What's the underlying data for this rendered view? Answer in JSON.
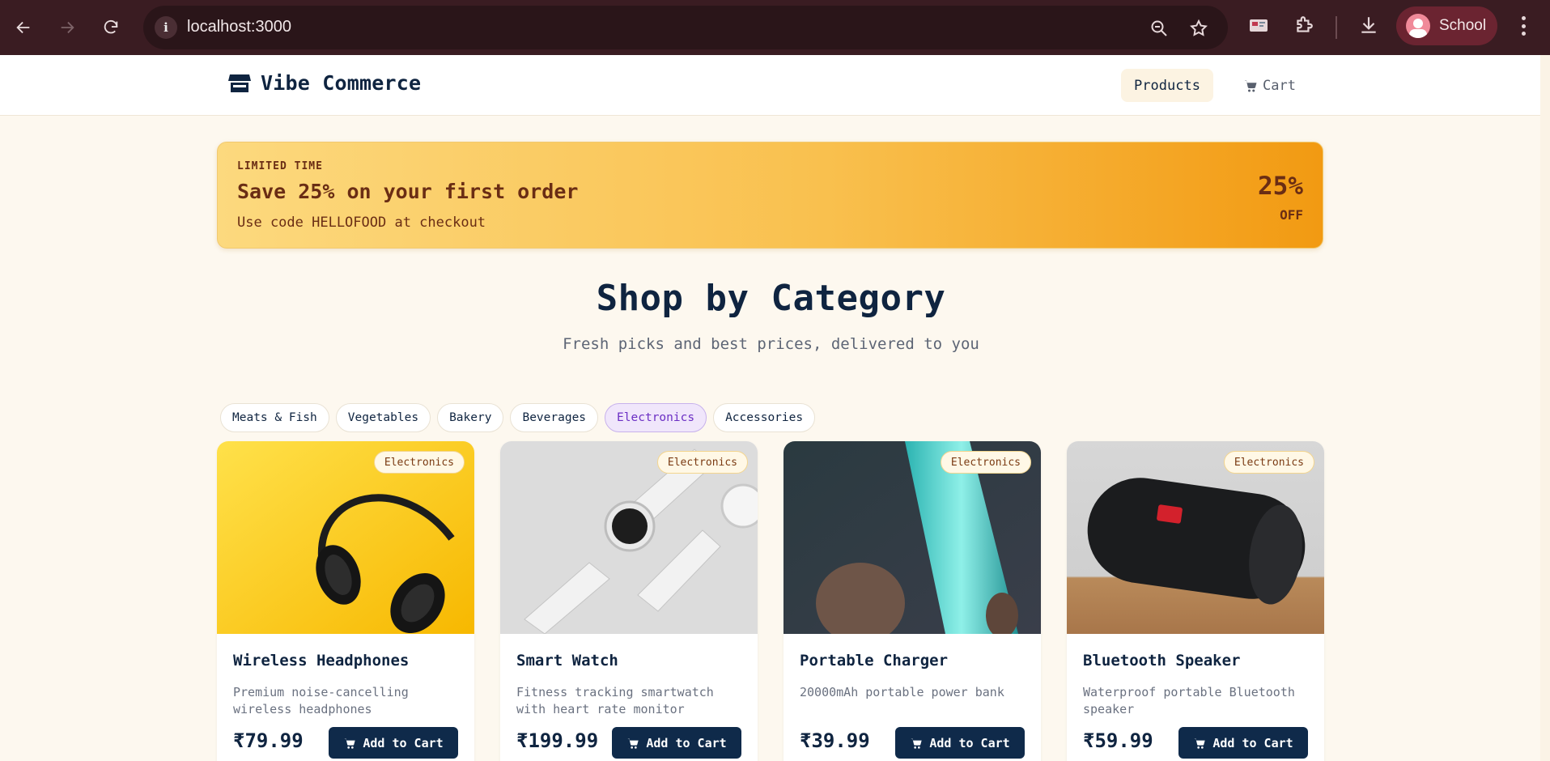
{
  "browser": {
    "url": "localhost:3000",
    "profile_name": "School"
  },
  "header": {
    "brand": "Vibe Commerce",
    "nav": {
      "products": "Products",
      "cart": "Cart"
    }
  },
  "promo": {
    "eyebrow": "LIMITED TIME",
    "headline": "Save 25% on your first order",
    "subtext": "Use code HELLOFOOD at checkout",
    "discount": "25%",
    "discount_suffix": "OFF"
  },
  "section": {
    "title": "Shop by Category",
    "subtitle": "Fresh picks and best prices, delivered to you"
  },
  "categories": {
    "items": [
      "Meats & Fish",
      "Vegetables",
      "Bakery",
      "Beverages",
      "Electronics",
      "Accessories"
    ],
    "selected": "Electronics"
  },
  "products": [
    {
      "name": "Wireless Headphones",
      "description": "Premium noise-cancelling wireless headphones",
      "price": "₹79.99",
      "category": "Electronics",
      "add_label": "Add to Cart",
      "image_icon": "headphones-image"
    },
    {
      "name": "Smart Watch",
      "description": "Fitness tracking smartwatch with heart rate monitor",
      "price": "₹199.99",
      "category": "Electronics",
      "add_label": "Add to Cart",
      "image_icon": "smartwatch-image"
    },
    {
      "name": "Portable Charger",
      "description": "20000mAh portable power bank",
      "price": "₹39.99",
      "category": "Electronics",
      "add_label": "Add to Cart",
      "image_icon": "power-bank-image"
    },
    {
      "name": "Bluetooth Speaker",
      "description": "Waterproof portable Bluetooth speaker",
      "price": "₹59.99",
      "category": "Electronics",
      "add_label": "Add to Cart",
      "image_icon": "speaker-image"
    }
  ],
  "colors": {
    "brand_navy": "#0f2440",
    "button_navy": "#0f2a4a",
    "promo_start": "#fcd97e",
    "promo_end": "#f29a12",
    "active_chip": "#6b2fc4",
    "page_bg": "#fdf8ef"
  }
}
